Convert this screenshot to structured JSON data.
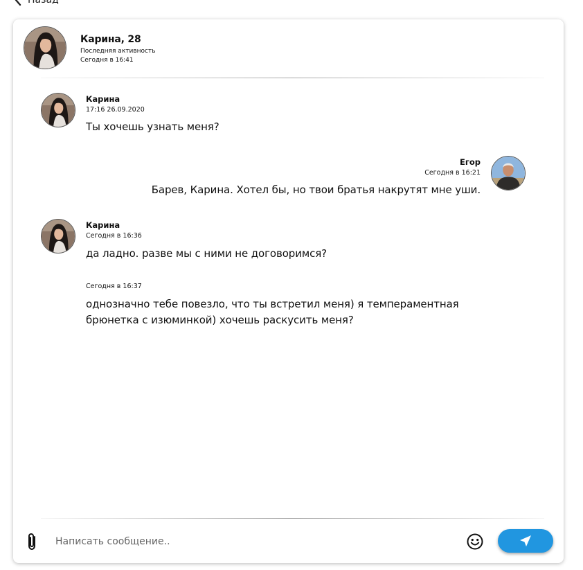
{
  "nav": {
    "back_label": "Назад"
  },
  "header": {
    "name": "Карина, 28",
    "status_label": "Последняя активность",
    "status_time": "Сегодня в 16:41"
  },
  "messages": [
    {
      "author": "Карина",
      "time": "17:16 26.09.2020",
      "text": "Ты хочешь узнать меня?",
      "side": "left"
    },
    {
      "author": "Егор",
      "time": "Сегодня в 16:21",
      "text": "Барев, Карина. Хотел бы, но твои братья накрутят мне уши.",
      "side": "right"
    },
    {
      "author": "Карина",
      "time": "Сегодня в 16:36",
      "text": "да ладно. разве мы с ними не договоримся?",
      "side": "left"
    },
    {
      "author": "",
      "time": "Сегодня в 16:37",
      "text": "однозначно тебе повезло, что ты встретил меня) я темпераментная брюнетка с изюминкой) хочешь раскусить меня?",
      "side": "left"
    }
  ],
  "composer": {
    "placeholder": "Написать сообщение..",
    "value": ""
  },
  "icons": {
    "back": "chevron-left-icon",
    "attach": "paperclip-icon",
    "emoji": "smiley-icon",
    "send": "paper-plane-icon"
  },
  "colors": {
    "send_button": "#2196e0",
    "text": "#111111"
  }
}
